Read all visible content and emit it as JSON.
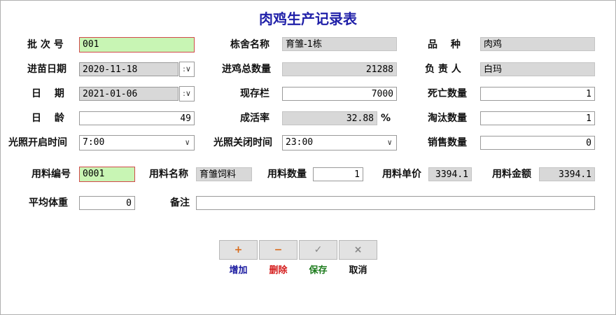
{
  "title": "肉鸡生产记录表",
  "fields": {
    "batch_label": "批 次 号",
    "batch_value": "001",
    "house_label": "栋舍名称",
    "house_value": "育雏-1栋",
    "breed_label": "品　 种",
    "breed_value": "肉鸡",
    "entry_date_label": "进苗日期",
    "entry_date_value": "2020-11-18",
    "total_label": "进鸡总数量",
    "total_value": "21288",
    "owner_label": "负 责 人",
    "owner_value": "白玛",
    "date_label": "日　 期",
    "date_value": "2021-01-06",
    "stock_label": "现存栏",
    "stock_value": "7000",
    "death_label": "死亡数量",
    "death_value": "1",
    "age_label": "日　 龄",
    "age_value": "49",
    "survival_label": "成活率",
    "survival_value": "32.88",
    "survival_unit": "%",
    "cull_label": "淘汰数量",
    "cull_value": "1",
    "light_on_label": "光照开启时间",
    "light_on_value": "7:00",
    "light_off_label": "光照关闭时间",
    "light_off_value": "23:00",
    "sales_label": "销售数量",
    "sales_value": "0",
    "feed_code_label": "用料编号",
    "feed_code_value": "0001",
    "feed_name_label": "用料名称",
    "feed_name_value": "育雏饲料",
    "feed_qty_label": "用料数量",
    "feed_qty_value": "1",
    "feed_price_label": "用料单价",
    "feed_price_value": "3394.1",
    "feed_amount_label": "用料金额",
    "feed_amount_value": "3394.1",
    "avg_weight_label": "平均体重",
    "avg_weight_value": "0",
    "remark_label": "备注",
    "remark_value": ""
  },
  "buttons": {
    "add": {
      "label": "增加",
      "glyph": "+",
      "color": "#1a1aa0",
      "glyph_color": "#d86a1a"
    },
    "delete": {
      "label": "删除",
      "glyph": "−",
      "color": "#d41a1a",
      "glyph_color": "#d86a1a"
    },
    "save": {
      "label": "保存",
      "glyph": "✓",
      "color": "#1a7a1a",
      "glyph_color": "#888888"
    },
    "cancel": {
      "label": "取消",
      "glyph": "×",
      "color": "#111111",
      "glyph_color": "#888888"
    }
  },
  "icons": {
    "dropdown": "chevron-down-icon",
    "spinner": "spin-icon"
  }
}
